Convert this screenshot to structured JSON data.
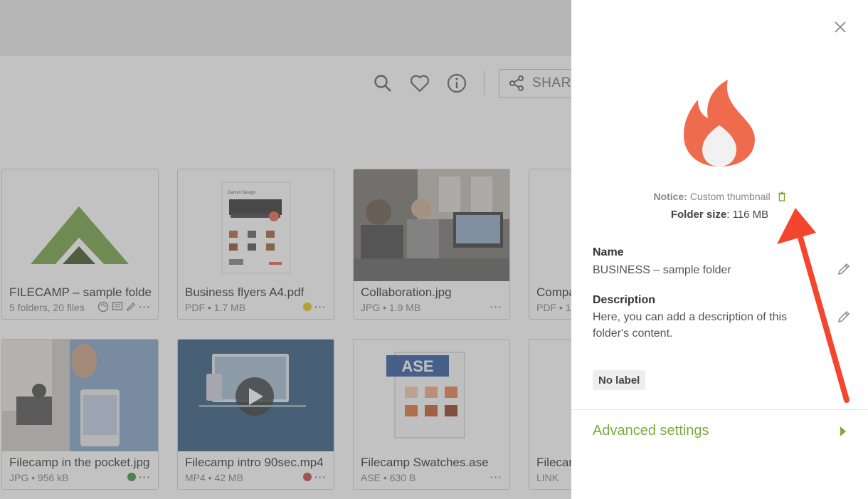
{
  "toolbar": {
    "share_label": "SHARE"
  },
  "cards": [
    {
      "title": "FILECAMP – sample folder",
      "meta": "5 folders, 20 files",
      "label_color": ""
    },
    {
      "title": "Business flyers A4.pdf",
      "meta": "PDF • 1.7 MB",
      "label_color": "#e4c200"
    },
    {
      "title": "Collaboration.jpg",
      "meta": "JPG • 1.9 MB",
      "label_color": ""
    },
    {
      "title": "Compa",
      "meta": "PDF • 1(",
      "label_color": ""
    },
    {
      "title": "Filecamp in the pocket.jpg",
      "meta": "JPG • 956 kB",
      "label_color": "#2a8a2a"
    },
    {
      "title": "Filecamp intro 90sec.mp4",
      "meta": "MP4 • 42 MB",
      "label_color": "#c0392b"
    },
    {
      "title": "Filecamp Swatches.ase",
      "meta": "ASE • 630 B",
      "label_color": ""
    },
    {
      "title": "Filecar",
      "meta": "LINK",
      "label_color": ""
    }
  ],
  "flyer": {
    "heading": "Danish Design."
  },
  "ase_label": "ASE",
  "panel": {
    "notice_label": "Notice:",
    "notice_text": "Custom thumbnail",
    "size_label": "Folder size",
    "size_value": ": 116 MB",
    "name_label": "Name",
    "name_value": "BUSINESS – sample folder",
    "desc_label": "Description",
    "desc_value": "Here, you can add a description of this folder's content.",
    "label_badge": "No label",
    "advanced": "Advanced settings"
  },
  "colors": {
    "accent_green": "#7bab3a",
    "flame": "#ef6b4e",
    "arrow_red": "#f4452f"
  }
}
